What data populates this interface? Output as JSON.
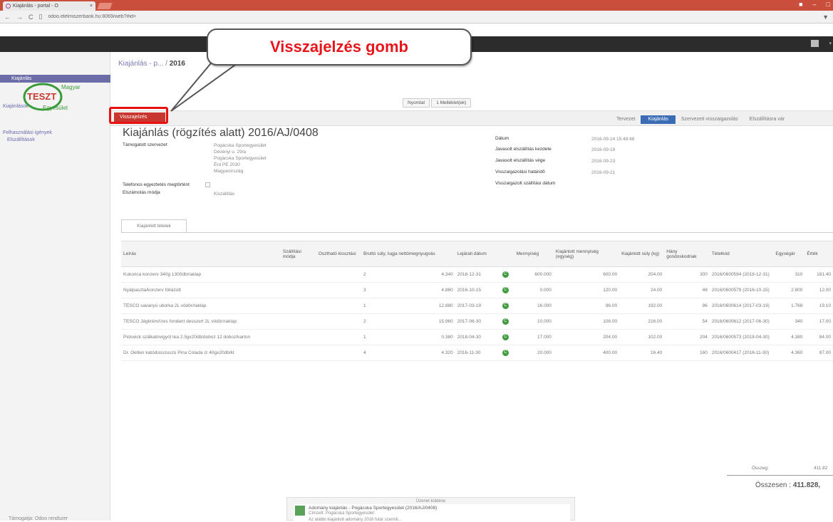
{
  "browser": {
    "tab_title": "Kiajánlás - portal - O",
    "url": "odoo.elelmiszerbank.hu:8069/web?#id=",
    "url_host": "odoo.elelmiszerbank.hu"
  },
  "callout": {
    "text": "Visszajelzés gomb"
  },
  "logo": {
    "word1": "Magyar",
    "word2": "TESZT",
    "word3": "Egyesület"
  },
  "sidebar": {
    "sections": [
      "Kiajánlások",
      "Kiajánlás",
      "Felhasználási igények",
      "Elszállítások"
    ],
    "powered": "Támogatja: Odoo rendszer"
  },
  "header": {
    "breadcrumb_parent": "Kiajánlás - p...",
    "breadcrumb_current": "2016",
    "pager_prev": "Nyomtat",
    "pager_next": "1 Melléklet(ek)"
  },
  "actions": {
    "feedback_button": "Visszajelzés"
  },
  "statusbar": {
    "steps": [
      "Tervezet",
      "Kiajánlás",
      "Szervezeti visszaigazolás",
      "Elszállításra vár"
    ],
    "active": "Kiajánlás"
  },
  "form": {
    "title": "Kiajánlás (rögzítés alatt) 2016/AJ/0408",
    "left": {
      "org_label": "Támogatott szervezet",
      "org_lines": [
        "Pogácska Sportegyesület",
        "Dévényi u. 29/a",
        "Pogácska Sportegyesület",
        "Érd PE 2030",
        "Magyarország"
      ],
      "phone_label": "Telefonos egyeztetés megtörtént",
      "delivery_label": "Elszámolás módja",
      "delivery_value": "Kiszállítás"
    },
    "right": {
      "date_label": "Dátum",
      "date_value": "2016-09-14 15:48:48",
      "start_label": "Javasolt elszállítás kezdete",
      "start_value": "2016-09-19",
      "end_label": "Javasolt elszállítás vége",
      "end_value": "2016-09-23",
      "confirm_label": "Visszaigazolási határidő",
      "confirm_value": "2016-09-21",
      "confirmed_label": "Visszaigazolt szállítási dátum"
    }
  },
  "tab": {
    "label": "Kiajánlott tételek"
  },
  "table": {
    "headers": [
      "Leírás",
      "Szállítási módja",
      "Osztható kiosztási",
      "Bruttó súly, lugja nettómegnyugvás",
      "Lejárati dátum",
      "",
      "Mennyiség",
      "Kiajánlott mennyiség (egység)",
      "Kiajánlott súly (kg)",
      "Hány gondoskodnak",
      "Tételkód",
      "Egységár",
      "Érték"
    ],
    "rows": [
      {
        "desc": "Kukorica konzerv 340g 1300db/raklap",
        "n": "2",
        "weight": "4.340",
        "exp": "2018-12-31",
        "qty": "600.000",
        "offered": "600.00",
        "kg": "204.00",
        "count": "300",
        "code": "2016/0600594 (2018-12-31)",
        "price": "310",
        "value": "181.40"
      },
      {
        "desc": "Nyálpaszta/konzerv fóliázott",
        "n": "3",
        "weight": "4.860",
        "exp": "2016-10-15",
        "qty": "0.000",
        "offered": "120.00",
        "kg": "24.00",
        "count": "48",
        "code": "2016/0600579 (2016-10-15)",
        "price": "2.800",
        "value": "12.00"
      },
      {
        "desc": "TESCO savanyú uborka 2L vödör/raklap",
        "n": "1",
        "weight": "12.880",
        "exp": "2017-03-19",
        "qty": "16.000",
        "offered": "96.00",
        "kg": "192.00",
        "count": "96",
        "code": "2016/0600614 (2017-03-19)",
        "price": "1.768",
        "value": "19.10"
      },
      {
        "desc": "TESCO Jégkrém/ízes fondant desszert 2L vödör/raklap",
        "n": "2",
        "weight": "15.960",
        "exp": "2017-06-30",
        "qty": "10.000",
        "offered": "108.00",
        "kg": "216.00",
        "count": "54",
        "code": "2016/0600612 (2017-06-30)",
        "price": "340",
        "value": "17.00"
      },
      {
        "desc": "Pickwick szálkatóvigyól tea 2.5gx20db/doboz 12 doboz/karton",
        "n": "1",
        "weight": "0.380",
        "exp": "2018-04-30",
        "qty": "17.000",
        "offered": "204.00",
        "kg": "102.00",
        "count": "204",
        "code": "2016/0600573 (2018-04-30)",
        "price": "4.380",
        "value": "84.00"
      },
      {
        "desc": "Dr. Oetker katódússzuszú Pina Colada íz 40gx20db/kt",
        "n": "4",
        "weight": "4.320",
        "exp": "2016-11-30",
        "qty": "20.000",
        "offered": "400.00",
        "kg": "16.40",
        "count": "160",
        "code": "2016/0600417 (2016-11-30)",
        "price": "4.360",
        "value": "87.00"
      }
    ]
  },
  "totals": {
    "subtotal_label": "Összeg:",
    "subtotal_value": "411.82",
    "total_label": "Összesen :",
    "total_value": "411.828,"
  },
  "chatter": {
    "header": "Üzenet küldése",
    "msg_title": "Adomány kiajánlás - Pogácska Sportegyesület (2016/AJ/0408)",
    "msg_sub": "Címzett: Pogácska Sportegyesület",
    "msg_body": "Az alábbi kiajánlott adomány 2016 futár szerinti..."
  },
  "colors": {
    "accent": "#6c6ca8",
    "feedback": "#c8372d",
    "highlight": "#e81010",
    "step_active": "#3a6db5",
    "topbar": "#2c2c2c"
  }
}
